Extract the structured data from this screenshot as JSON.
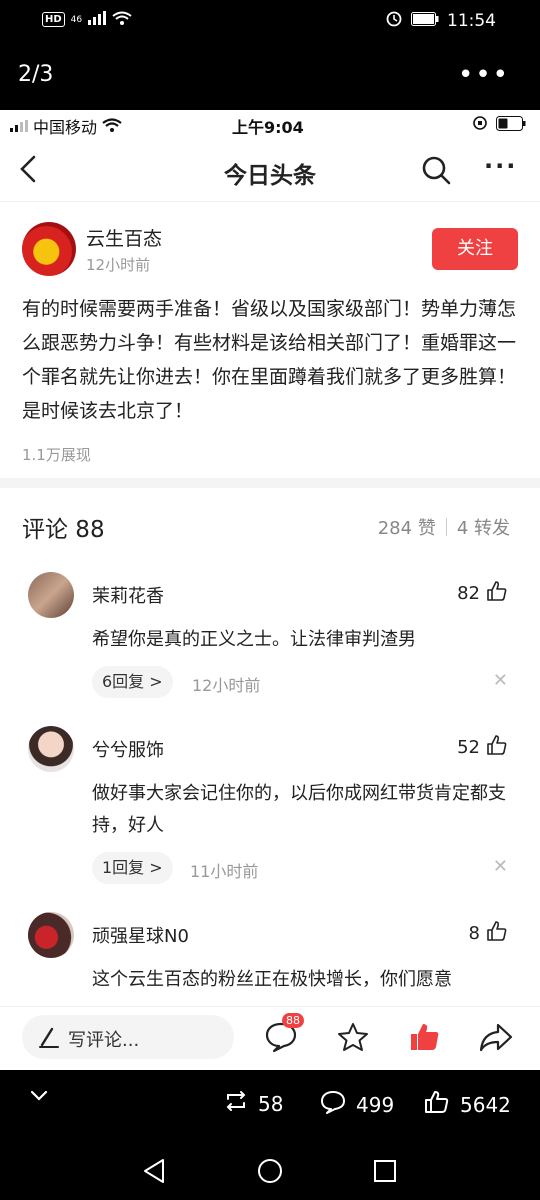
{
  "system": {
    "hd": "HD",
    "net": "46",
    "time": "11:54"
  },
  "viewer": {
    "counter": "2/3",
    "more": "•••"
  },
  "inner_status": {
    "carrier": "中国移动",
    "time": "上午9:04"
  },
  "navbar": {
    "title": "今日头条"
  },
  "post": {
    "author": "云生百态",
    "time": "12小时前",
    "follow_label": "关注",
    "body": "有的时候需要两手准备！省级以及国家级部门！势单力薄怎么跟恶势力斗争！有些材料是该给相关部门了！重婚罪这一个罪名就先让你进去！你在里面蹲着我们就多了更多胜算！是时候该去北京了！",
    "views": "1.1万展现"
  },
  "comments_header": {
    "title": "评论 88",
    "likes": "284 赞",
    "shares": "4 转发"
  },
  "comments": [
    {
      "name": "茉莉花香",
      "likes": "82",
      "text": "希望你是真的正义之士。让法律审判渣男",
      "replies": "6回复 >",
      "time": "12小时前"
    },
    {
      "name": "兮兮服饰",
      "likes": "52",
      "text": "做好事大家会记住你的，以后你成网红带货肯定都支持，好人",
      "replies": "1回复 >",
      "time": "11小时前"
    },
    {
      "name": "顽强星球N0",
      "likes": "8",
      "text": "这个云生百态的粉丝正在极快增长，你们愿意"
    }
  ],
  "bottom_bar": {
    "write_placeholder": "写评论...",
    "comment_badge": "88"
  },
  "viewer_footer": {
    "reposts": "58",
    "comments": "499",
    "likes": "5642"
  },
  "colors": {
    "accent_red": "#f04142",
    "muted_text": "#999999"
  }
}
